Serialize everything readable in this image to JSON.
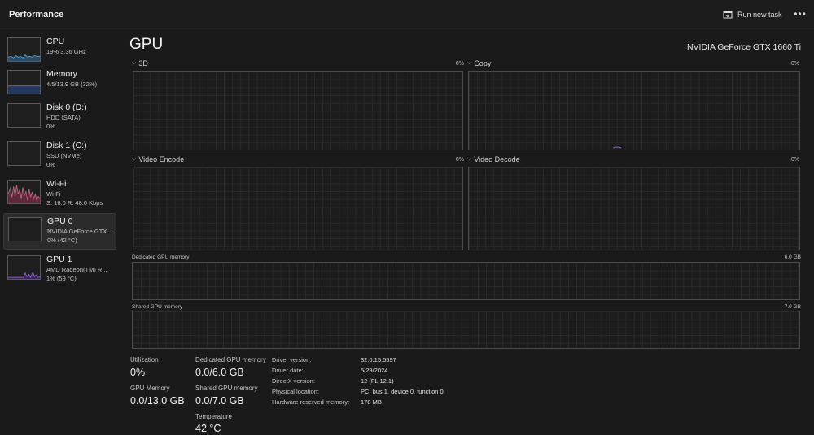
{
  "app": {
    "title": "Performance",
    "run_new_task": "Run new task",
    "more": "•••"
  },
  "sidebar": {
    "items": [
      {
        "name": "CPU",
        "lines": [
          "19% 3.36 GHz"
        ],
        "graph_color": "#4a9fd8"
      },
      {
        "name": "Memory",
        "lines": [
          "4.5/13.9 GB (32%)"
        ],
        "graph_color": "#4a78d8"
      },
      {
        "name": "Disk 0 (D:)",
        "lines": [
          "HDD (SATA)",
          "0%"
        ],
        "graph_color": "#6fae3c"
      },
      {
        "name": "Disk 1 (C:)",
        "lines": [
          "SSD (NVMe)",
          "0%"
        ],
        "graph_color": "#6fae3c"
      },
      {
        "name": "Wi-Fi",
        "lines": [
          "Wi-Fi",
          "S: 16.0 R: 48.0 Kbps"
        ],
        "graph_color": "#c0607a"
      },
      {
        "name": "GPU 0",
        "lines": [
          "NVIDIA GeForce GTX...",
          "0% (42 °C)"
        ],
        "graph_color": "#8a5ac8",
        "selected": true
      },
      {
        "name": "GPU 1",
        "lines": [
          "AMD Radeon(TM) R...",
          "1% (59 °C)"
        ],
        "graph_color": "#8a5ac8"
      }
    ]
  },
  "main": {
    "title": "GPU",
    "model": "NVIDIA GeForce GTX 1660 Ti",
    "engines": [
      {
        "label": "3D",
        "percent": "0%"
      },
      {
        "label": "Copy",
        "percent": "0%"
      },
      {
        "label": "Video Encode",
        "percent": "0%"
      },
      {
        "label": "Video Decode",
        "percent": "0%"
      }
    ],
    "dedicated_memory": {
      "label": "Dedicated GPU memory",
      "max": "6.0 GB"
    },
    "shared_memory": {
      "label": "Shared GPU memory",
      "max": "7.0 GB"
    }
  },
  "stats": {
    "utilization": {
      "label": "Utilization",
      "value": "0%"
    },
    "dedicated": {
      "label": "Dedicated GPU memory",
      "value": "0.0/6.0 GB"
    },
    "gpu_memory": {
      "label": "GPU Memory",
      "value": "0.0/13.0 GB"
    },
    "shared": {
      "label": "Shared GPU memory",
      "value": "0.0/7.0 GB"
    },
    "temperature": {
      "label": "Temperature",
      "value": "42 °C"
    }
  },
  "info": [
    {
      "key": "Driver version:",
      "value": "32.0.15.5597"
    },
    {
      "key": "Driver date:",
      "value": "5/29/2024"
    },
    {
      "key": "DirectX version:",
      "value": "12 (FL 12.1)"
    },
    {
      "key": "Physical location:",
      "value": "PCI bus 1, device 0, function 0"
    },
    {
      "key": "Hardware reserved memory:",
      "value": "178 MB"
    }
  ]
}
